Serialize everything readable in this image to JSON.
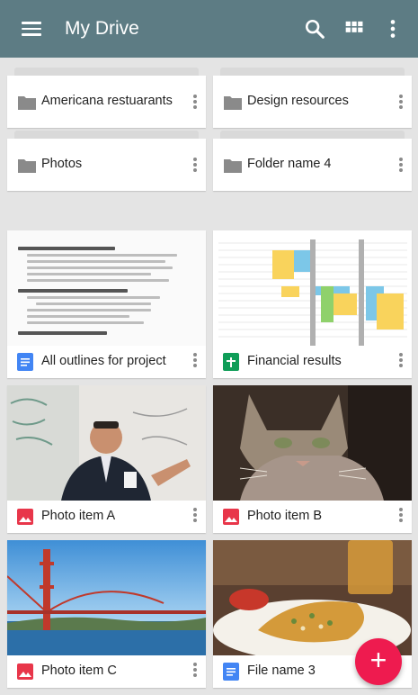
{
  "appbar": {
    "title": "My Drive",
    "icons": [
      "menu-icon",
      "search-icon",
      "grid-view-icon",
      "more-vert-icon"
    ]
  },
  "folders": [
    {
      "name": "Americana restuarants"
    },
    {
      "name": "Design resources"
    },
    {
      "name": "Photos"
    },
    {
      "name": "Folder name 4"
    }
  ],
  "files": [
    {
      "name": "All outlines for project",
      "type": "document",
      "icon": "docs-icon"
    },
    {
      "name": "Financial results",
      "type": "spreadsheet",
      "icon": "sheets-icon"
    },
    {
      "name": "Photo item A",
      "type": "photo",
      "icon": "image-icon"
    },
    {
      "name": "Photo item B",
      "type": "photo",
      "icon": "image-icon"
    },
    {
      "name": "Photo item C",
      "type": "photo",
      "icon": "image-icon"
    },
    {
      "name": "File name 3",
      "type": "document",
      "icon": "docs-icon"
    }
  ],
  "colors": {
    "appbar": "#5d7c84",
    "background": "#e4e4e4",
    "docs": "#4285f4",
    "sheets": "#0f9d58",
    "image": "#e8364a",
    "fab": "#ee1b4f"
  },
  "fab": {
    "icon": "add-icon",
    "label": "+"
  }
}
